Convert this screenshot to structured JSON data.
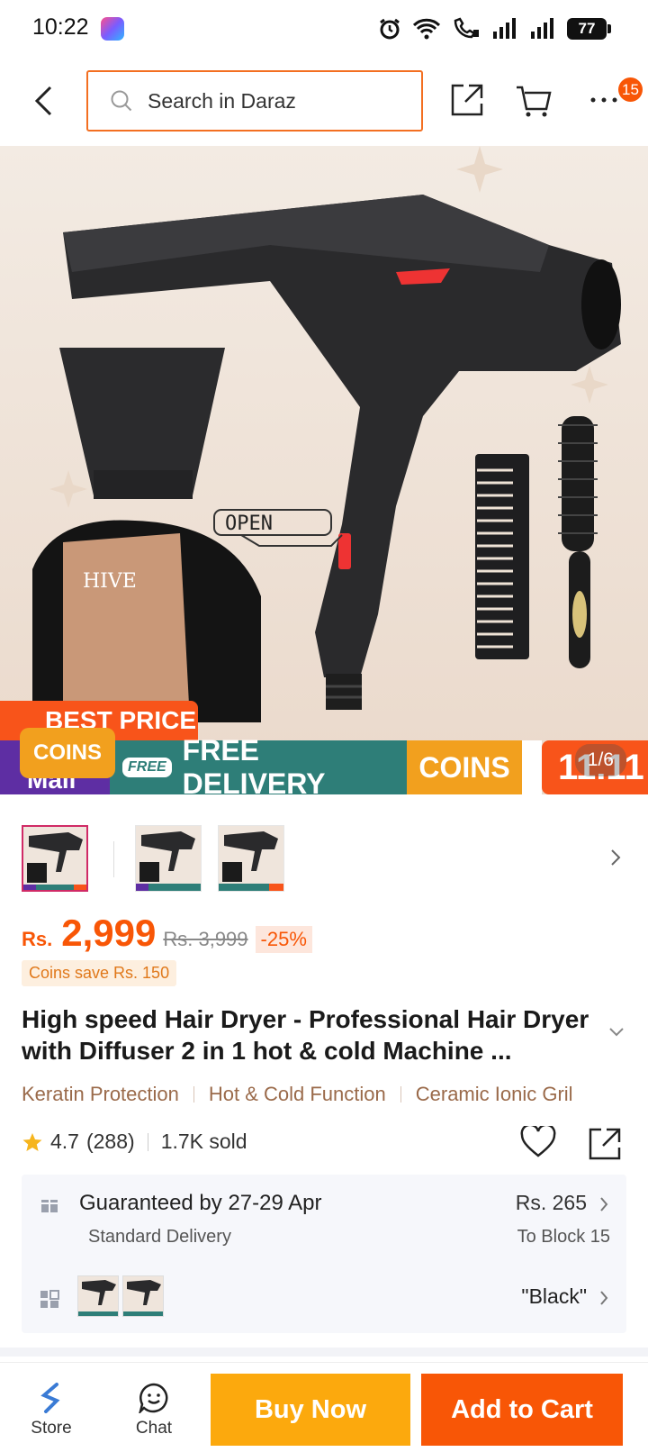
{
  "status_bar": {
    "time": "10:22",
    "battery": "77"
  },
  "header": {
    "search_placeholder": "Search in Daraz",
    "cart_badge": "15"
  },
  "hero": {
    "counter": "1/6",
    "best_price_label": "BEST PRICE",
    "coins_tag": "COINS",
    "strip_mall": "Mall",
    "strip_free_icon": "FREE",
    "strip_free_delivery": "FREE DELIVERY",
    "strip_coins": "COINS",
    "strip_sale": "11.11",
    "box_brand": "HIVE",
    "open_label": "OPEN"
  },
  "price": {
    "currency": "Rs.",
    "current": "2,999",
    "original": "Rs. 3,999",
    "discount": "-25%",
    "coins_save": "Coins save Rs. 150"
  },
  "product": {
    "title": "High speed Hair Dryer - Professional Hair Dryer with Diffuser 2 in 1 hot & cold Machine ...",
    "tags": [
      "Keratin Protection",
      "Hot & Cold Function",
      "Ceramic Ionic Gril"
    ],
    "rating": "4.7",
    "reviews": "(288)",
    "sold": "1.7K sold"
  },
  "delivery": {
    "title": "Guaranteed by 27-29 Apr",
    "subtitle": "Standard Delivery",
    "fee": "Rs. 265",
    "destination": "To Block 15"
  },
  "variant": {
    "selected": "\"Black\""
  },
  "bottom_bar": {
    "store_label": "Store",
    "chat_label": "Chat",
    "buy_now": "Buy Now",
    "add_to_cart": "Add to Cart"
  },
  "colors": {
    "accent": "#f85606",
    "buy_now": "#fca90d",
    "search_border": "#f36f21"
  }
}
